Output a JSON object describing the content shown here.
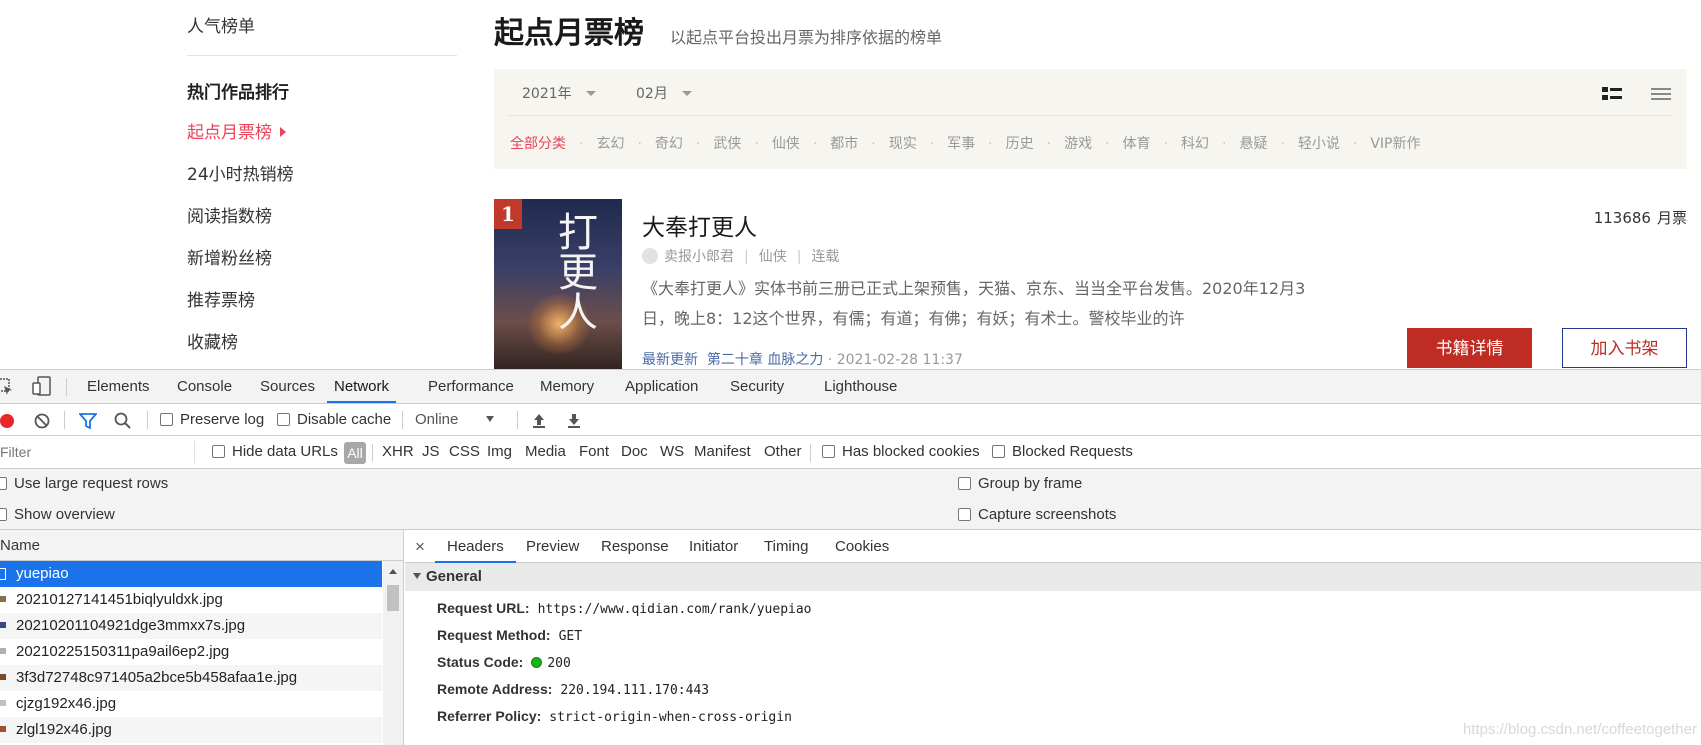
{
  "webpage": {
    "left_nav": {
      "top_item": "人气榜单",
      "section_heading": "热门作品排行",
      "items": [
        "起点月票榜",
        "24小时热销榜",
        "阅读指数榜",
        "新增粉丝榜",
        "推荐票榜",
        "收藏榜"
      ],
      "active_index": 0
    },
    "title": "起点月票榜",
    "subtitle": "以起点平台投出月票为排序依据的榜单",
    "filters": {
      "year": "2021年",
      "month": "02月",
      "categories": [
        "全部分类",
        "玄幻",
        "奇幻",
        "武侠",
        "仙侠",
        "都市",
        "现实",
        "军事",
        "历史",
        "游戏",
        "体育",
        "科幻",
        "悬疑",
        "轻小说",
        "VIP新作"
      ],
      "active_category": "全部分类"
    },
    "book": {
      "rank": "1",
      "title": "大奉打更人",
      "author": "卖报小郎君",
      "category": "仙侠",
      "status": "连载",
      "description": "《大奉打更人》实体书前三册已正式上架预售，天猫、京东、当当全平台发售。2020年12月3日，晚上8：12这个世界，有儒；有道；有佛；有妖；有术士。警校毕业的许",
      "update_label": "最新更新",
      "latest_chapter": "第二十章 血脉之力",
      "update_time": "2021-02-28 11:37",
      "votes": "113686",
      "votes_unit": "月票",
      "detail_button": "书籍详情",
      "shelf_button": "加入书架",
      "cover_text": "打更人"
    }
  },
  "devtools": {
    "tabs": [
      "Elements",
      "Console",
      "Sources",
      "Network",
      "Performance",
      "Memory",
      "Application",
      "Security",
      "Lighthouse"
    ],
    "active_tab": "Network",
    "toolbar": {
      "preserve_log": "Preserve log",
      "disable_cache": "Disable cache",
      "throttle": "Online"
    },
    "filter_bar": {
      "placeholder": "Filter",
      "hide_data_urls": "Hide data URLs",
      "types": [
        "All",
        "XHR",
        "JS",
        "CSS",
        "Img",
        "Media",
        "Font",
        "Doc",
        "WS",
        "Manifest",
        "Other"
      ],
      "has_blocked_cookies": "Has blocked cookies",
      "blocked_requests": "Blocked Requests"
    },
    "settings": {
      "large_rows": "Use large request rows",
      "show_overview": "Show overview",
      "group_by_frame": "Group by frame",
      "capture_screenshots": "Capture screenshots"
    },
    "requests": {
      "header": "Name",
      "rows": [
        "yuepiao",
        "20210127141451biqlyuldxk.jpg",
        "20210201104921dge3mmxx7s.jpg",
        "20210225150311pa9ail6ep2.jpg",
        "3f3d72748c971405a2bce5b458afaa1e.jpg",
        "cjzg192x46.jpg",
        "zlgl192x46.jpg"
      ],
      "selected_index": 0
    },
    "detail": {
      "close": "×",
      "tabs": [
        "Headers",
        "Preview",
        "Response",
        "Initiator",
        "Timing",
        "Cookies"
      ],
      "active_tab": "Headers",
      "section": "General",
      "fields": [
        {
          "key": "Request URL:",
          "value": "https://www.qidian.com/rank/yuepiao"
        },
        {
          "key": "Request Method:",
          "value": "GET"
        },
        {
          "key": "Status Code:",
          "value": "200"
        },
        {
          "key": "Remote Address:",
          "value": "220.194.111.170:443"
        },
        {
          "key": "Referrer Policy:",
          "value": "strict-origin-when-cross-origin"
        }
      ]
    }
  },
  "watermark": "https://blog.csdn.net/coffeetogether",
  "colors": {
    "accent_red": "#ed4259",
    "button_red": "#bf2c24",
    "devtools_blue": "#1a73e8",
    "status_green": "#19b019"
  }
}
